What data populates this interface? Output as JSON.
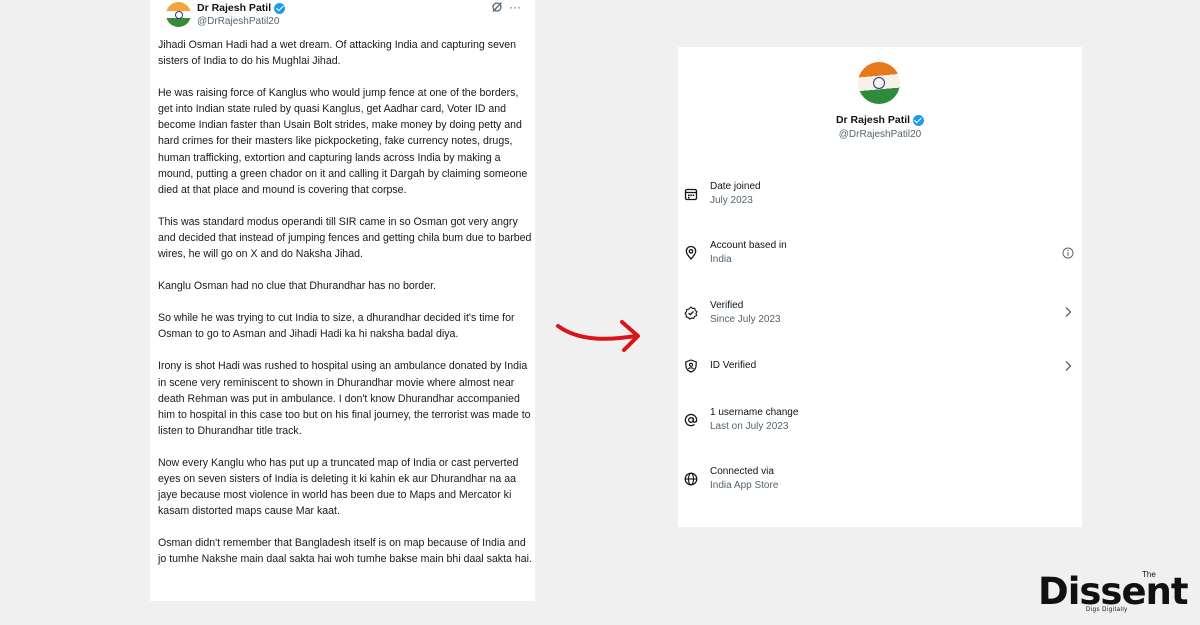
{
  "tweet": {
    "name": "Dr Rajesh Patil",
    "handle": "@DrRajeshPatil20",
    "action_icons": [
      "grok-icon",
      "more-icon"
    ],
    "more_label": "···",
    "paragraphs": [
      "Jihadi Osman Hadi had a wet dream. Of attacking India and capturing seven sisters of India to do his Mughlai Jihad.",
      "He was raising force of Kanglus who would jump fence at one of the borders, get into Indian state ruled by quasi Kanglus, get Aadhar card, Voter ID and become Indian faster than Usain Bolt strides, make money by doing petty and hard crimes for their masters like pickpocketing, fake currency notes, drugs, human trafficking, extortion and capturing lands across India by making a mound, putting a green chador on it and calling it Dargah by claiming someone died at that place and mound is covering that corpse.",
      "This was standard modus operandi till SIR came in so Osman got very angry and decided that instead of jumping fences and getting chila bum due to barbed wires, he will go on X and do Naksha Jihad.",
      "Kanglu Osman had no clue that Dhurandhar has no border.",
      "So while he was trying to cut India to size, a dhurandhar decided it's time for Osman to go to Asman and Jihadi Hadi ka hi naksha badal diya.",
      "Irony is shot Hadi was rushed to hospital using an ambulance donated by India in scene very reminiscent to shown in Dhurandhar movie where almost near death Rehman was put in ambulance. I don't know Dhurandhar accompanied him to hospital in this case too but on his final journey, the terrorist was made to listen to Dhurandhar title track.",
      "Now every Kanglu who has put up a truncated map of India or cast perverted eyes on seven sisters of India is deleting it ki kahin ek aur Dhurandhar na aa jaye because most violence in world has been due to Maps and Mercator ki kasam distorted maps cause Mar kaat.",
      "Osman didn't remember that Bangladesh itself is on map because of India and jo tumhe Nakshe main daal sakta hai woh tumhe bakse main bhi daal sakta hai."
    ]
  },
  "profile": {
    "name": "Dr Rajesh Patil",
    "handle": "@DrRajeshPatil20",
    "rows": [
      {
        "icon": "calendar-icon",
        "title": "Date joined",
        "value": "July 2023",
        "end": ""
      },
      {
        "icon": "location-pin-icon",
        "title": "Account based in",
        "value": "India",
        "end": "info-icon"
      },
      {
        "icon": "verified-badge-icon",
        "title": "Verified",
        "value": "Since July 2023",
        "end": "chevron-right-icon"
      },
      {
        "icon": "id-shield-icon",
        "title": "ID Verified",
        "value": "",
        "end": "chevron-right-icon"
      },
      {
        "icon": "at-sign-icon",
        "title": "1 username change",
        "value": "Last on July 2023",
        "end": ""
      },
      {
        "icon": "globe-icon",
        "title": "Connected via",
        "value": "India App Store",
        "end": ""
      }
    ]
  },
  "logo": {
    "word": "Dissent",
    "the": "The",
    "tagline": "Digs Digitally"
  },
  "colors": {
    "background": "#f0f0f0",
    "verified_blue": "#1d9bf0",
    "arrow_red": "#d9141b",
    "secondary_text": "#536471"
  }
}
